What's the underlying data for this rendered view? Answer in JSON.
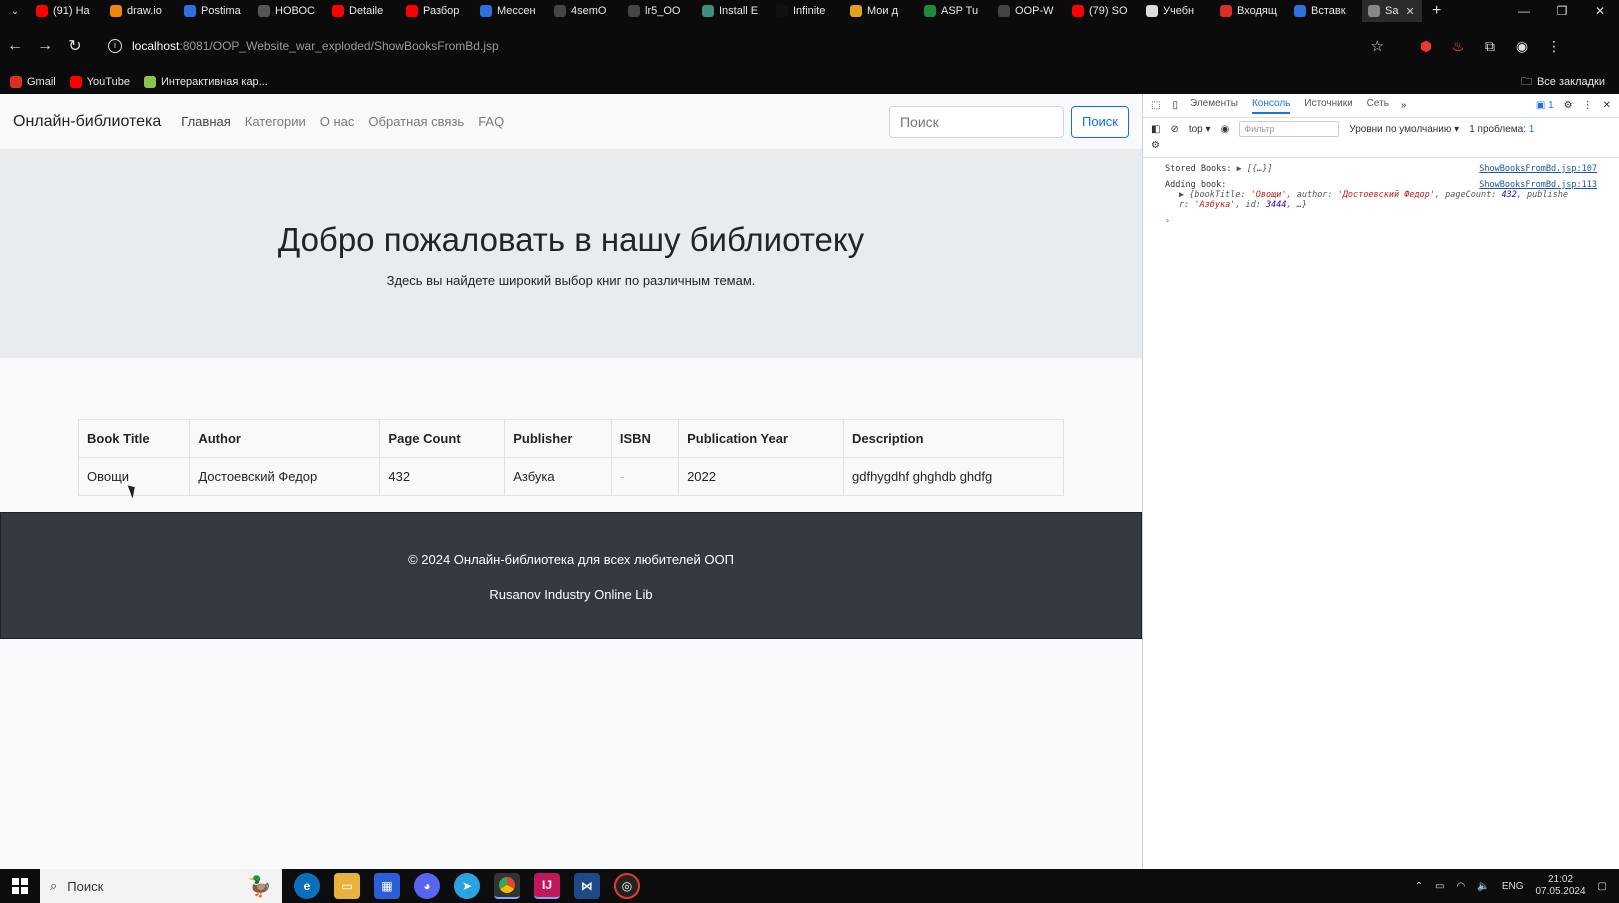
{
  "browser": {
    "tabs": [
      {
        "label": "(91) На",
        "color": "#ff0000"
      },
      {
        "label": "draw.io",
        "color": "#f08705"
      },
      {
        "label": "Postima",
        "color": "#2f6fde"
      },
      {
        "label": "НОВОС",
        "color": "#555555"
      },
      {
        "label": "Detaile",
        "color": "#ff0000"
      },
      {
        "label": "Разбор",
        "color": "#ff0000"
      },
      {
        "label": "Мессен",
        "color": "#2f6fde"
      },
      {
        "label": "4semO",
        "color": "#444444"
      },
      {
        "label": "lr5_OO",
        "color": "#444444"
      },
      {
        "label": "Install E",
        "color": "#3c8f7c"
      },
      {
        "label": "Infinite",
        "color": "#111111"
      },
      {
        "label": "Мои д",
        "color": "#e0a020"
      },
      {
        "label": "ASP Tu",
        "color": "#1b8a3e"
      },
      {
        "label": "OOP-W",
        "color": "#444444"
      },
      {
        "label": "(79) SO",
        "color": "#ff0000"
      },
      {
        "label": "Учебн",
        "color": "#dddddd"
      },
      {
        "label": "Входящ",
        "color": "#d93025"
      },
      {
        "label": "Вставк",
        "color": "#2f6fde"
      },
      {
        "label": "Sa",
        "color": "#888888",
        "active": true
      }
    ],
    "new_tab_symbol": "+",
    "url_host": "localhost",
    "url_path": ":8081/OOP_Website_war_exploded/ShowBooksFromBd.jsp",
    "bookmarks": [
      {
        "label": "Gmail",
        "color": "#d93025"
      },
      {
        "label": "YouTube",
        "color": "#ff0000"
      },
      {
        "label": "Интерактивная кар...",
        "color": "#8bc34a"
      }
    ],
    "all_bookmarks": "Все закладки"
  },
  "site": {
    "brand": "Онлайн-библиотека",
    "nav": [
      "Главная",
      "Категории",
      "О нас",
      "Обратная связь",
      "FAQ"
    ],
    "search_placeholder": "Поиск",
    "search_button": "Поиск",
    "hero_title": "Добро пожаловать в нашу библиотеку",
    "hero_subtitle": "Здесь вы найдете широкий выбор книг по различным темам.",
    "table": {
      "headers": [
        "Book Title",
        "Author",
        "Page Count",
        "Publisher",
        "ISBN",
        "Publication Year",
        "Description"
      ],
      "rows": [
        [
          "Овощи",
          "Достоевский Федор",
          "432",
          "Азбука",
          "-",
          "2022",
          "gdfhygdhf ghghdb ghdfg"
        ]
      ]
    },
    "footer_line1": "© 2024 Онлайн-библиотека для всех любителей ООП",
    "footer_line2": "Rusanov Industry Online Lib"
  },
  "devtools": {
    "tabs": [
      "Элементы",
      "Консоль",
      "Источники",
      "Сеть"
    ],
    "active_tab": "Консоль",
    "more": "»",
    "issues_count": "1",
    "context": "top",
    "filter_placeholder": "Фильтр",
    "levels": "Уровни по умолчанию",
    "problems": "1 проблема:",
    "problems_count": "1",
    "logs": [
      {
        "text": "Stored Books: ",
        "obj": "▶ [{…}]",
        "source": "ShowBooksFromBd.jsp:107"
      },
      {
        "text": "Adding book:",
        "source": "ShowBooksFromBd.jsp:113"
      }
    ],
    "book_obj": {
      "prefix": "▶ {bookTitle: ",
      "title": "'Овощи'",
      "author_key": ", author: ",
      "author": "'Достоевский Федор'",
      "pc_key": ", pageCount: ",
      "pc": "432",
      "pub_key": ", publishe",
      "line2_start": "r: ",
      "publisher": "'Азбука'",
      "id_key": ", id: ",
      "id": "3444",
      "rest": ", …}"
    },
    "prompt": "›"
  },
  "taskbar": {
    "search_label": "Поиск",
    "lang": "ENG",
    "time": "21:02",
    "date": "07.05.2024"
  }
}
